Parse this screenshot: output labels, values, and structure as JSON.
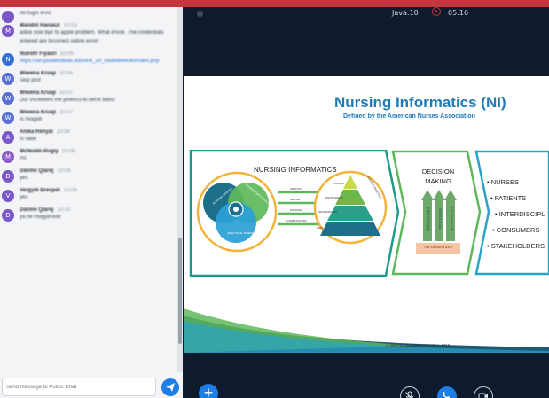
{
  "session": {
    "timer": "Java:10",
    "rec_time": "05:16"
  },
  "chat": {
    "messages": [
      {
        "name": "",
        "time": "",
        "text": "ski tugis ervic",
        "avatar_color": "#7b57c9",
        "avatar_letter": "",
        "link": false
      },
      {
        "name": "Mandril Hanaszi",
        "time": "10:03",
        "text": "adike yow bye to apple problem. What ervoe. The credentials entered are Incorrect online error!",
        "avatar_color": "#7b57c9",
        "avatar_letter": "M",
        "link": false
      },
      {
        "name": "Nueshr Fiyasri",
        "time": "10:05",
        "text": "https://sin.pollaentBias.edu/link_url_kedelweerarl/index.php",
        "avatar_color": "#2f6fd6",
        "avatar_letter": "N",
        "link": true
      },
      {
        "name": "Wiwena Kruaji",
        "time": "10:06",
        "text": "Skip prof",
        "avatar_color": "#5a6fd6",
        "avatar_letter": "W",
        "link": false
      },
      {
        "name": "Wiwena Kruaji",
        "time": "10:07",
        "text": "Our incredient me pinkecs et bernt belist",
        "avatar_color": "#5a6fd6",
        "avatar_letter": "W",
        "link": false
      },
      {
        "name": "Wiwena Kruaji",
        "time": "10:07",
        "text": "Is mogyill",
        "avatar_color": "#5a6fd6",
        "avatar_letter": "W",
        "link": false
      },
      {
        "name": "Anika Rehyal",
        "time": "10:08",
        "text": "Is nalie",
        "avatar_color": "#7b57c9",
        "avatar_letter": "A",
        "link": false
      },
      {
        "name": "McNuldo Rugiy",
        "time": "10:08",
        "text": "Po",
        "avatar_color": "#8a5cc4",
        "avatar_letter": "M",
        "link": false
      },
      {
        "name": "Davine Qlarej",
        "time": "10:09",
        "text": "yes",
        "avatar_color": "#7b57c9",
        "avatar_letter": "D",
        "link": false
      },
      {
        "name": "Vergydi Brespet",
        "time": "10:09",
        "text": "yes",
        "avatar_color": "#7b57c9",
        "avatar_letter": "V",
        "link": false
      },
      {
        "name": "Davine Qlarej",
        "time": "10:10",
        "text": "ya ne mogyill edit",
        "avatar_color": "#7b57c9",
        "avatar_letter": "D",
        "link": false
      }
    ],
    "input_placeholder": "Send message to Public Chat"
  },
  "slide": {
    "title": "Nursing Informatics (NI)",
    "subtitle": "Defined by the American Nurses Association",
    "ni_section_title": "NURSING INFORMATICS",
    "venn_labels": [
      "NURSING SCIENCE",
      "INFORMATION SCIENCE",
      "ANALYTICAL SCIENCE"
    ],
    "arrow_labels": [
      "IDENTIFY",
      "DEFINE",
      "MANAGE",
      "COMMUNICATE"
    ],
    "pyramid_labels": [
      "WISDOM",
      "KNOWLEDGE",
      "INFORMATION",
      "DATA"
    ],
    "pyramid_side_label": "NURSING PRACTICE",
    "decision_title": "DECISION MAKING",
    "pillars": [
      "STRUCTURES",
      "PROCESSES",
      "TECHNOLOGY"
    ],
    "pillar_base": "INFORMATION",
    "list": [
      "• NURSES",
      "• PATIENTS",
      "• INTERDISCIPL",
      "• CONSUMERS",
      "• STAKEHOLDERS"
    ],
    "citation": "(American Nurses Association, 2015)"
  },
  "colors": {
    "brand_red": "#c4363d",
    "accent_blue": "#1f7ee6",
    "background": "#0f1b2d",
    "green": "#5db85a",
    "teal": "#1d6f8a"
  }
}
